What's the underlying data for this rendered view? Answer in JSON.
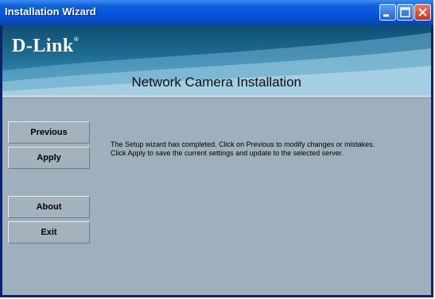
{
  "window": {
    "title": "Installation Wizard"
  },
  "banner": {
    "brand": "D-Link",
    "trademark": "®",
    "title": "Network Camera Installation"
  },
  "sidebar": {
    "buttons": [
      {
        "label": "Previous"
      },
      {
        "label": "Apply"
      },
      {
        "label": "About"
      },
      {
        "label": "Exit"
      }
    ]
  },
  "message": {
    "line1": "The Setup wizard has completed. Click on Previous to modify changes or mistakes.",
    "line2": "Click Apply to save the current settings and update to the selected server."
  },
  "icons": {
    "minimize": "minimize-icon",
    "maximize": "maximize-icon",
    "close": "close-icon"
  },
  "colors": {
    "titlebar": "#0553dd",
    "banner": "#1f6d93",
    "panel": "#9eb0bb",
    "close_button": "#c8341a"
  }
}
